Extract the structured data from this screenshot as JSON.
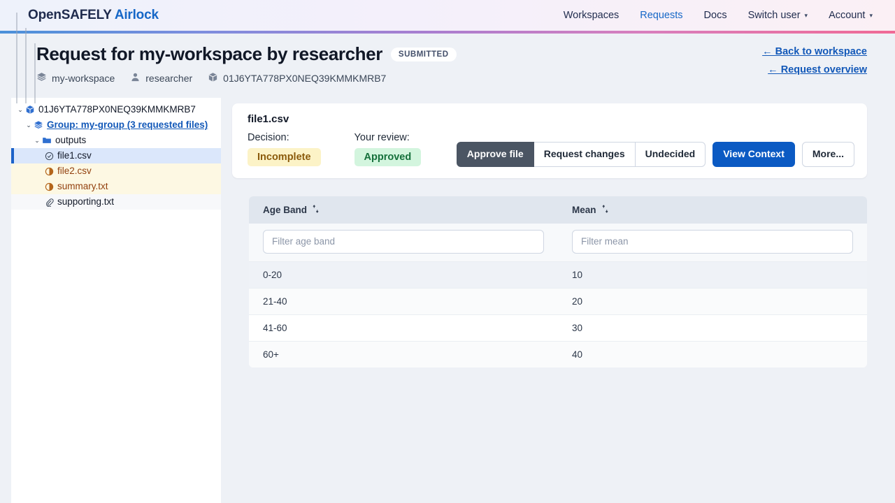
{
  "navbar": {
    "brand_main": "OpenSAFELY",
    "brand_accent": "Airlock",
    "links": [
      {
        "label": "Workspaces",
        "active": false,
        "caret": false
      },
      {
        "label": "Requests",
        "active": true,
        "caret": false
      },
      {
        "label": "Docs",
        "active": false,
        "caret": false
      },
      {
        "label": "Switch user",
        "active": false,
        "caret": true
      },
      {
        "label": "Account",
        "active": false,
        "caret": true
      }
    ],
    "caret_glyph": "▾"
  },
  "header": {
    "title": "Request for my-workspace by researcher",
    "status": "SUBMITTED",
    "meta": {
      "workspace": "my-workspace",
      "user": "researcher",
      "request_id": "01J6YTA778PX0NEQ39KMMKMRB7"
    },
    "back_to_workspace": "← Back to workspace",
    "request_overview": "← Request overview"
  },
  "tree": {
    "twisty_open": "⌄",
    "nodes": [
      {
        "label": "01J6YTA778PX0NEQ39KMMKMRB7",
        "icon": "cube-icon",
        "level": 0,
        "style": "dark",
        "row": "plain"
      },
      {
        "label": "Group: my-group (3 requested files)",
        "icon": "layers-icon",
        "level": 1,
        "style": "link",
        "row": "plain"
      },
      {
        "label": "outputs",
        "icon": "folder-icon",
        "level": 2,
        "style": "dark",
        "row": "plain"
      },
      {
        "label": "file1.csv",
        "icon": "check-circle-icon",
        "level": 3,
        "style": "dark",
        "row": "selected"
      },
      {
        "label": "file2.csv",
        "icon": "half-circle-icon",
        "level": 3,
        "style": "amber",
        "row": "cream"
      },
      {
        "label": "summary.txt",
        "icon": "half-circle-icon",
        "level": 3,
        "style": "amber",
        "row": "cream"
      },
      {
        "label": "supporting.txt",
        "icon": "paperclip-icon",
        "level": 3,
        "style": "dark",
        "row": "faint"
      }
    ]
  },
  "file_card": {
    "file_name": "file1.csv",
    "decision_label": "Decision:",
    "decision_value": "Incomplete",
    "review_label": "Your review:",
    "review_value": "Approved",
    "buttons": {
      "approve": "Approve file",
      "request_changes": "Request changes",
      "undecided": "Undecided",
      "view_context": "View Context",
      "more": "More..."
    }
  },
  "table": {
    "columns": [
      {
        "header": "Age Band",
        "filter_placeholder": "Filter age band",
        "filter_value": ""
      },
      {
        "header": "Mean",
        "filter_placeholder": "Filter mean",
        "filter_value": ""
      }
    ],
    "rows": [
      [
        "0-20",
        "10"
      ],
      [
        "21-40",
        "20"
      ],
      [
        "41-60",
        "30"
      ],
      [
        "60+",
        "40"
      ]
    ]
  },
  "colors": {
    "accent_blue": "#1667c7",
    "link_blue": "#1258b8",
    "primary_button": "#0b5ac3",
    "dark_button": "#4b5563",
    "incomplete_bg": "#fcf3c7",
    "incomplete_text": "#8a5a0b",
    "approved_bg": "#d3f5de",
    "approved_text": "#15703b",
    "page_bg": "#eef1f6"
  }
}
